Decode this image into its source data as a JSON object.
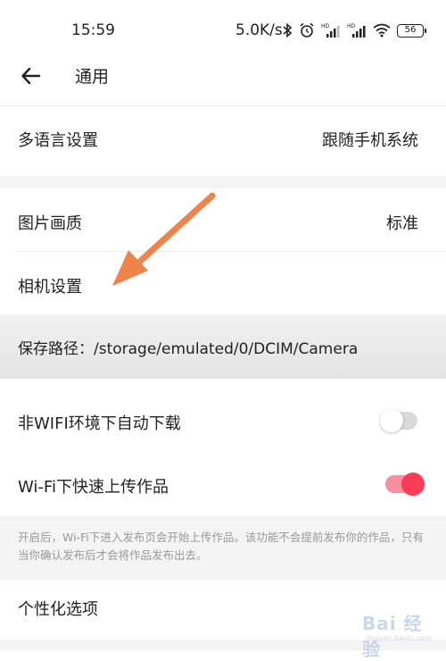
{
  "status_bar": {
    "time": "15:59",
    "network_speed": "5.0K/s",
    "battery": "56",
    "icons": [
      "bluetooth-icon",
      "alarm-icon",
      "signal-hd-icon",
      "signal-hd-icon",
      "wifi-icon",
      "battery-icon"
    ]
  },
  "header": {
    "title": "通用",
    "back_icon": "back-arrow-icon"
  },
  "settings": {
    "language": {
      "label": "多语言设置",
      "value": "跟随手机系统"
    },
    "image_quality": {
      "label": "图片画质",
      "value": "标准"
    },
    "camera": {
      "label": "相机设置"
    },
    "save_path": {
      "label": "保存路径：/storage/emulated/0/DCIM/Camera"
    },
    "auto_download": {
      "label": "非WIFI环境下自动下载",
      "enabled": false
    },
    "fast_upload": {
      "label": "Wi-Fi下快速上传作品",
      "enabled": true,
      "note": "开启后，Wi-Fi下进入发布页会开始上传作品。该功能不会提前发布你的作品，只有当你确认发布后才会将作品发布出去。"
    },
    "personalization": {
      "label": "个性化选项"
    }
  },
  "watermark": {
    "brand": "Bai 经验",
    "url": "jingyan.baidu.com"
  },
  "colors": {
    "toggle_on": "#fd3b55",
    "toggle_on_track": "#f58fa1",
    "toggle_off_track": "#d9d9d9",
    "annotation_arrow": "#f0834a",
    "section_gap": "#f4f4f4"
  }
}
